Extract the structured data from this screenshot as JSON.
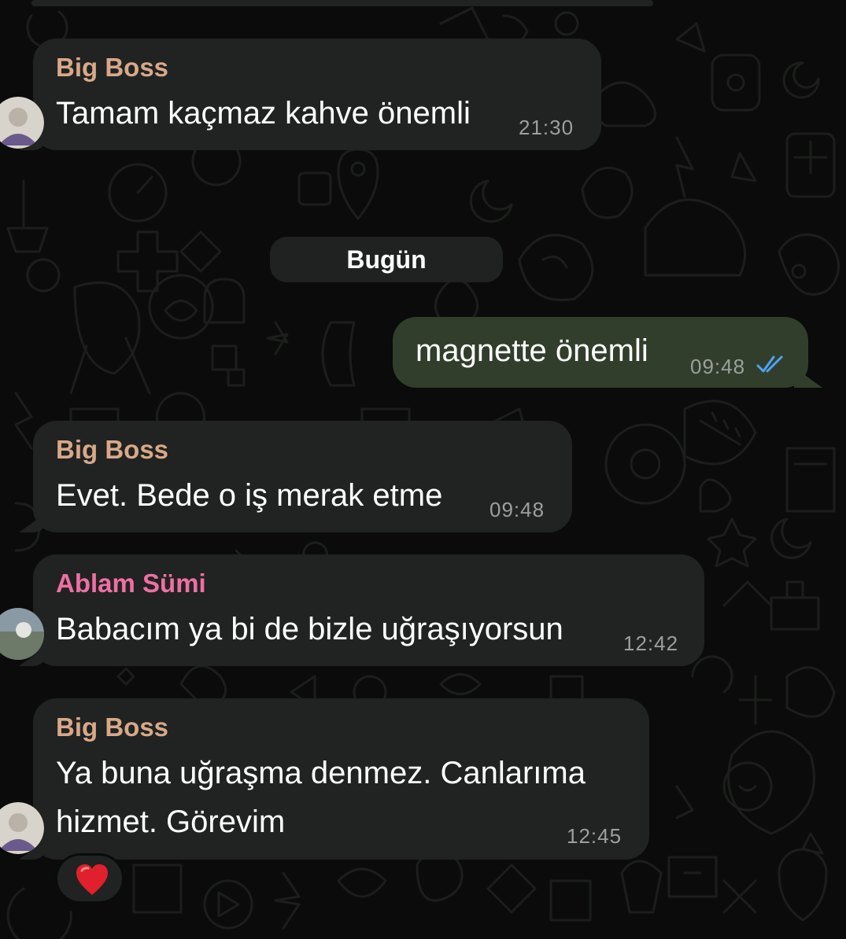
{
  "date_separator": "Bugün",
  "messages": [
    {
      "sender": "Big Boss",
      "text": "Tamam kaçmaz kahve önemli",
      "time": "21:30",
      "direction": "incoming"
    },
    {
      "text": "magnette önemli",
      "time": "09:48",
      "direction": "outgoing",
      "status": "read"
    },
    {
      "sender": "Big Boss",
      "text": "Evet. Bede o iş merak etme",
      "time": "09:48",
      "direction": "incoming"
    },
    {
      "sender": "Ablam Sümi",
      "text": "Babacım ya bi de bizle uğraşıyorsun",
      "time": "12:42",
      "direction": "incoming"
    },
    {
      "sender": "Big Boss",
      "text_lines": [
        "Ya buna uğraşma denmez. Canlarıma",
        "hizmet. Görevim"
      ],
      "time": "12:45",
      "direction": "incoming",
      "reaction": "heart-emoji"
    }
  ],
  "colors": {
    "background": "#0b0b0b",
    "incoming_bubble": "#202322",
    "outgoing_bubble": "#313e2c",
    "sender_big_boss": "#d9a888",
    "sender_ablam_sumi": "#ef6fa4",
    "read_checks": "#4fa3f5",
    "reaction_heart": "#e0202c"
  }
}
